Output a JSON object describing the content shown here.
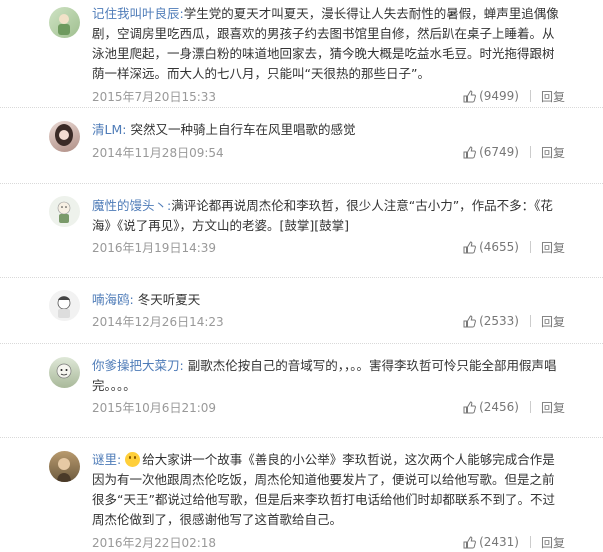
{
  "comments": [
    {
      "user": "记住我叫叶良辰:",
      "text": "学生党的夏天才叫夏天，漫长得让人失去耐性的暑假，蝉声里追偶像剧，空调房里吃西瓜，跟喜欢的男孩子约去图书馆里自修，然后趴在桌子上睡着。从泳池里爬起，一身漂白粉的味道地回家去，猜今晚大概是吃益水毛豆。时光拖得跟树荫一样深远。而大人的七八月，只能叫“天很热的那些日子”。",
      "time": "2015年7月20日15:33",
      "likes": "(9499)",
      "reply": "回复"
    },
    {
      "user": "清LM:",
      "text": "突然又一种骑上自行车在风里唱歌的感觉",
      "time": "2014年11月28日09:54",
      "likes": "(6749)",
      "reply": "回复"
    },
    {
      "user": "魔性的馒头丶:",
      "text": "满评论都再说周杰伦和李玖哲，很少人注意“古小力”，作品不多：《花海》《说了再见》，方文山的老婆。[鼓掌][鼓掌]",
      "time": "2016年1月19日14:39",
      "likes": "(4655)",
      "reply": "回复"
    },
    {
      "user": "喃海鸥:",
      "text": "冬天听夏天",
      "time": "2014年12月26日14:23",
      "likes": "(2533)",
      "reply": "回复"
    },
    {
      "user": "你爹操把大菜刀:",
      "text": "副歌杰伦按自己的音域写的，，。。害得李玖哲可怜只能全部用假声唱完。。。。",
      "time": "2015年10月6日21:09",
      "likes": "(2456)",
      "reply": "回复"
    },
    {
      "user": "谜里:",
      "text": "给大家讲一个故事《善良的小公举》李玖哲说，这次两个人能够完成合作是因为有一次他跟周杰伦吃饭，周杰伦知道他要发片了，便说可以给他写歌。但是之前很多“天王”都说过给他写歌，但是后来李玖哲打电话给他们时却都联系不到了。不过周杰伦做到了，很感谢他写了这首歌给自己。",
      "time": "2016年2月22日02:18",
      "likes": "(2431)",
      "reply": "回复"
    }
  ],
  "colors": {
    "name": "#4f7cb8",
    "text": "#333333",
    "meta": "#999999"
  }
}
